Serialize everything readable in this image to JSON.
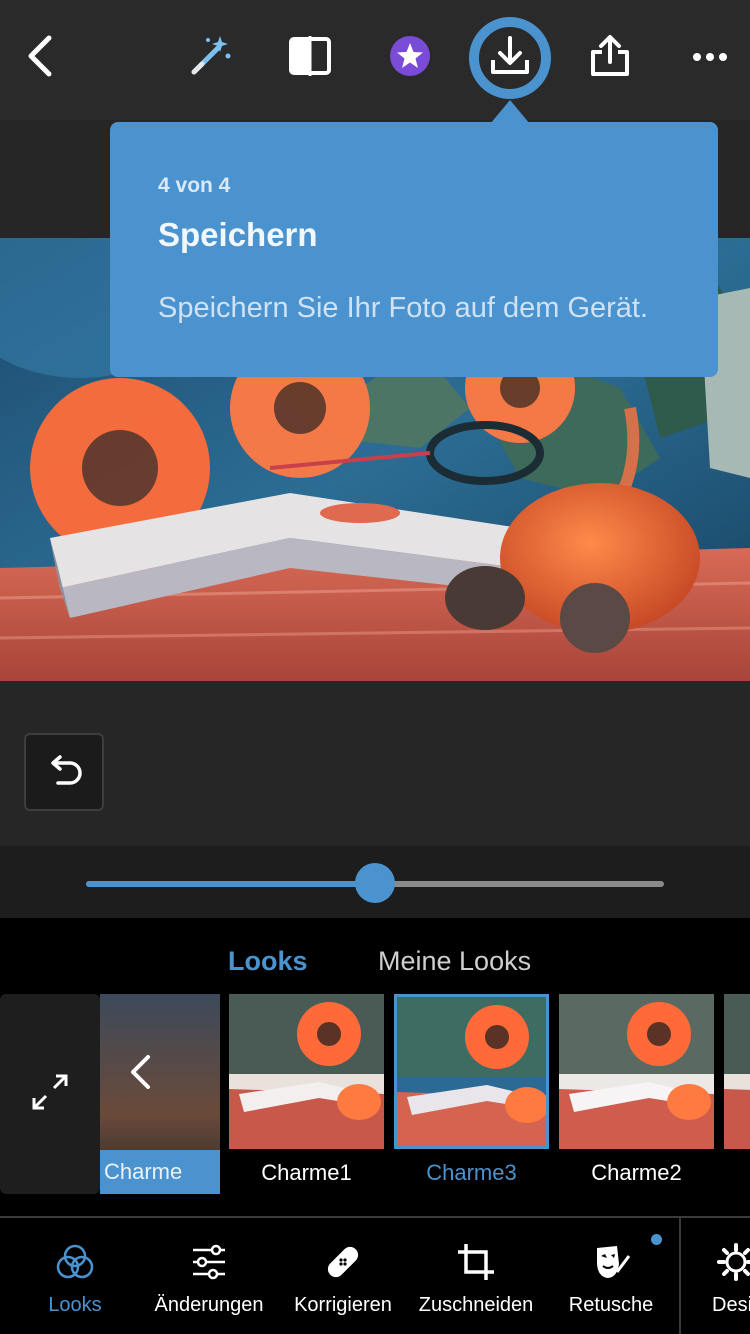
{
  "toolbar": {
    "back": "back-icon",
    "auto": "magic-wand-icon",
    "compare": "compare-icon",
    "premium": "star-badge-icon",
    "save": "download-icon",
    "share": "share-icon",
    "more": "more-icon"
  },
  "tooltip": {
    "step": "4 von 4",
    "title": "Speichern",
    "description": "Speichern Sie Ihr Foto auf dem Gerät."
  },
  "slider": {
    "value": 0.5
  },
  "looks": {
    "tabs": [
      {
        "label": "Looks",
        "active": true
      },
      {
        "label": "Meine Looks",
        "active": false
      }
    ],
    "group_label": "Charme",
    "items": [
      {
        "label": "Charme1",
        "selected": false
      },
      {
        "label": "Charme3",
        "selected": true
      },
      {
        "label": "Charme2",
        "selected": false
      }
    ]
  },
  "nav": {
    "items": [
      {
        "label": "Looks",
        "active": true,
        "icon": "looks-icon"
      },
      {
        "label": "Änderungen",
        "active": false,
        "icon": "sliders-icon"
      },
      {
        "label": "Korrigieren",
        "active": false,
        "icon": "bandage-icon"
      },
      {
        "label": "Zuschneiden",
        "active": false,
        "icon": "crop-icon"
      },
      {
        "label": "Retusche",
        "active": false,
        "icon": "face-paint-icon"
      },
      {
        "label": "Desi",
        "active": false,
        "icon": "gear-icon"
      }
    ]
  },
  "colors": {
    "accent": "#4a93cf",
    "toolbar_bg": "#2a2a2a",
    "panel_bg": "#000000",
    "premium": "#7a4bd6"
  }
}
